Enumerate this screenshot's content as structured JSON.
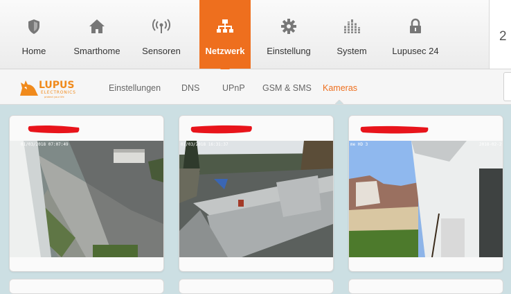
{
  "nav": {
    "items": [
      {
        "label": "Home",
        "icon": "shield-icon"
      },
      {
        "label": "Smarthome",
        "icon": "house-icon"
      },
      {
        "label": "Sensoren",
        "icon": "signal-icon"
      },
      {
        "label": "Netzwerk",
        "icon": "network-icon",
        "active": true
      },
      {
        "label": "Einstellung",
        "icon": "gear-icon"
      },
      {
        "label": "System",
        "icon": "equalizer-icon"
      },
      {
        "label": "Lupusec 24",
        "icon": "lock-icon"
      }
    ],
    "right_text": "2"
  },
  "logo": {
    "name": "LUPUS",
    "sub": "ELECTRONICS",
    "tagline": "protect your life"
  },
  "subnav": {
    "items": [
      {
        "label": "Einstellungen"
      },
      {
        "label": "DNS"
      },
      {
        "label": "UPnP"
      },
      {
        "label": "GSM & SMS"
      },
      {
        "label": "Kameras",
        "active": true
      }
    ]
  },
  "cameras": [
    {
      "timestamp": "01/03/2018 07:07:49"
    },
    {
      "timestamp": "01/03/2018 16:31:37"
    },
    {
      "overlay": "me HD 3",
      "timestamp": "2018-02-2"
    }
  ],
  "colors": {
    "accent": "#ee6f1e",
    "background": "#ccdfe3",
    "redaction": "#e8141b"
  }
}
